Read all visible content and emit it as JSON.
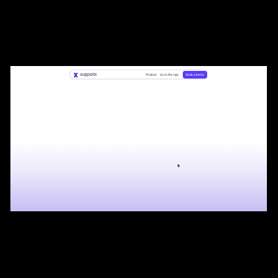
{
  "nav": {
    "brand": "supportx",
    "logo_icon": "supportx-logo-icon",
    "links": [
      "Product",
      "Go to the App"
    ],
    "cta_label": "Book a Demo"
  },
  "colors": {
    "accent": "#5b3df5",
    "gradient_bottom": "#c7bef3",
    "background": "#000000",
    "page": "#ffffff"
  },
  "cursor_icon": "mouse-pointer-icon"
}
